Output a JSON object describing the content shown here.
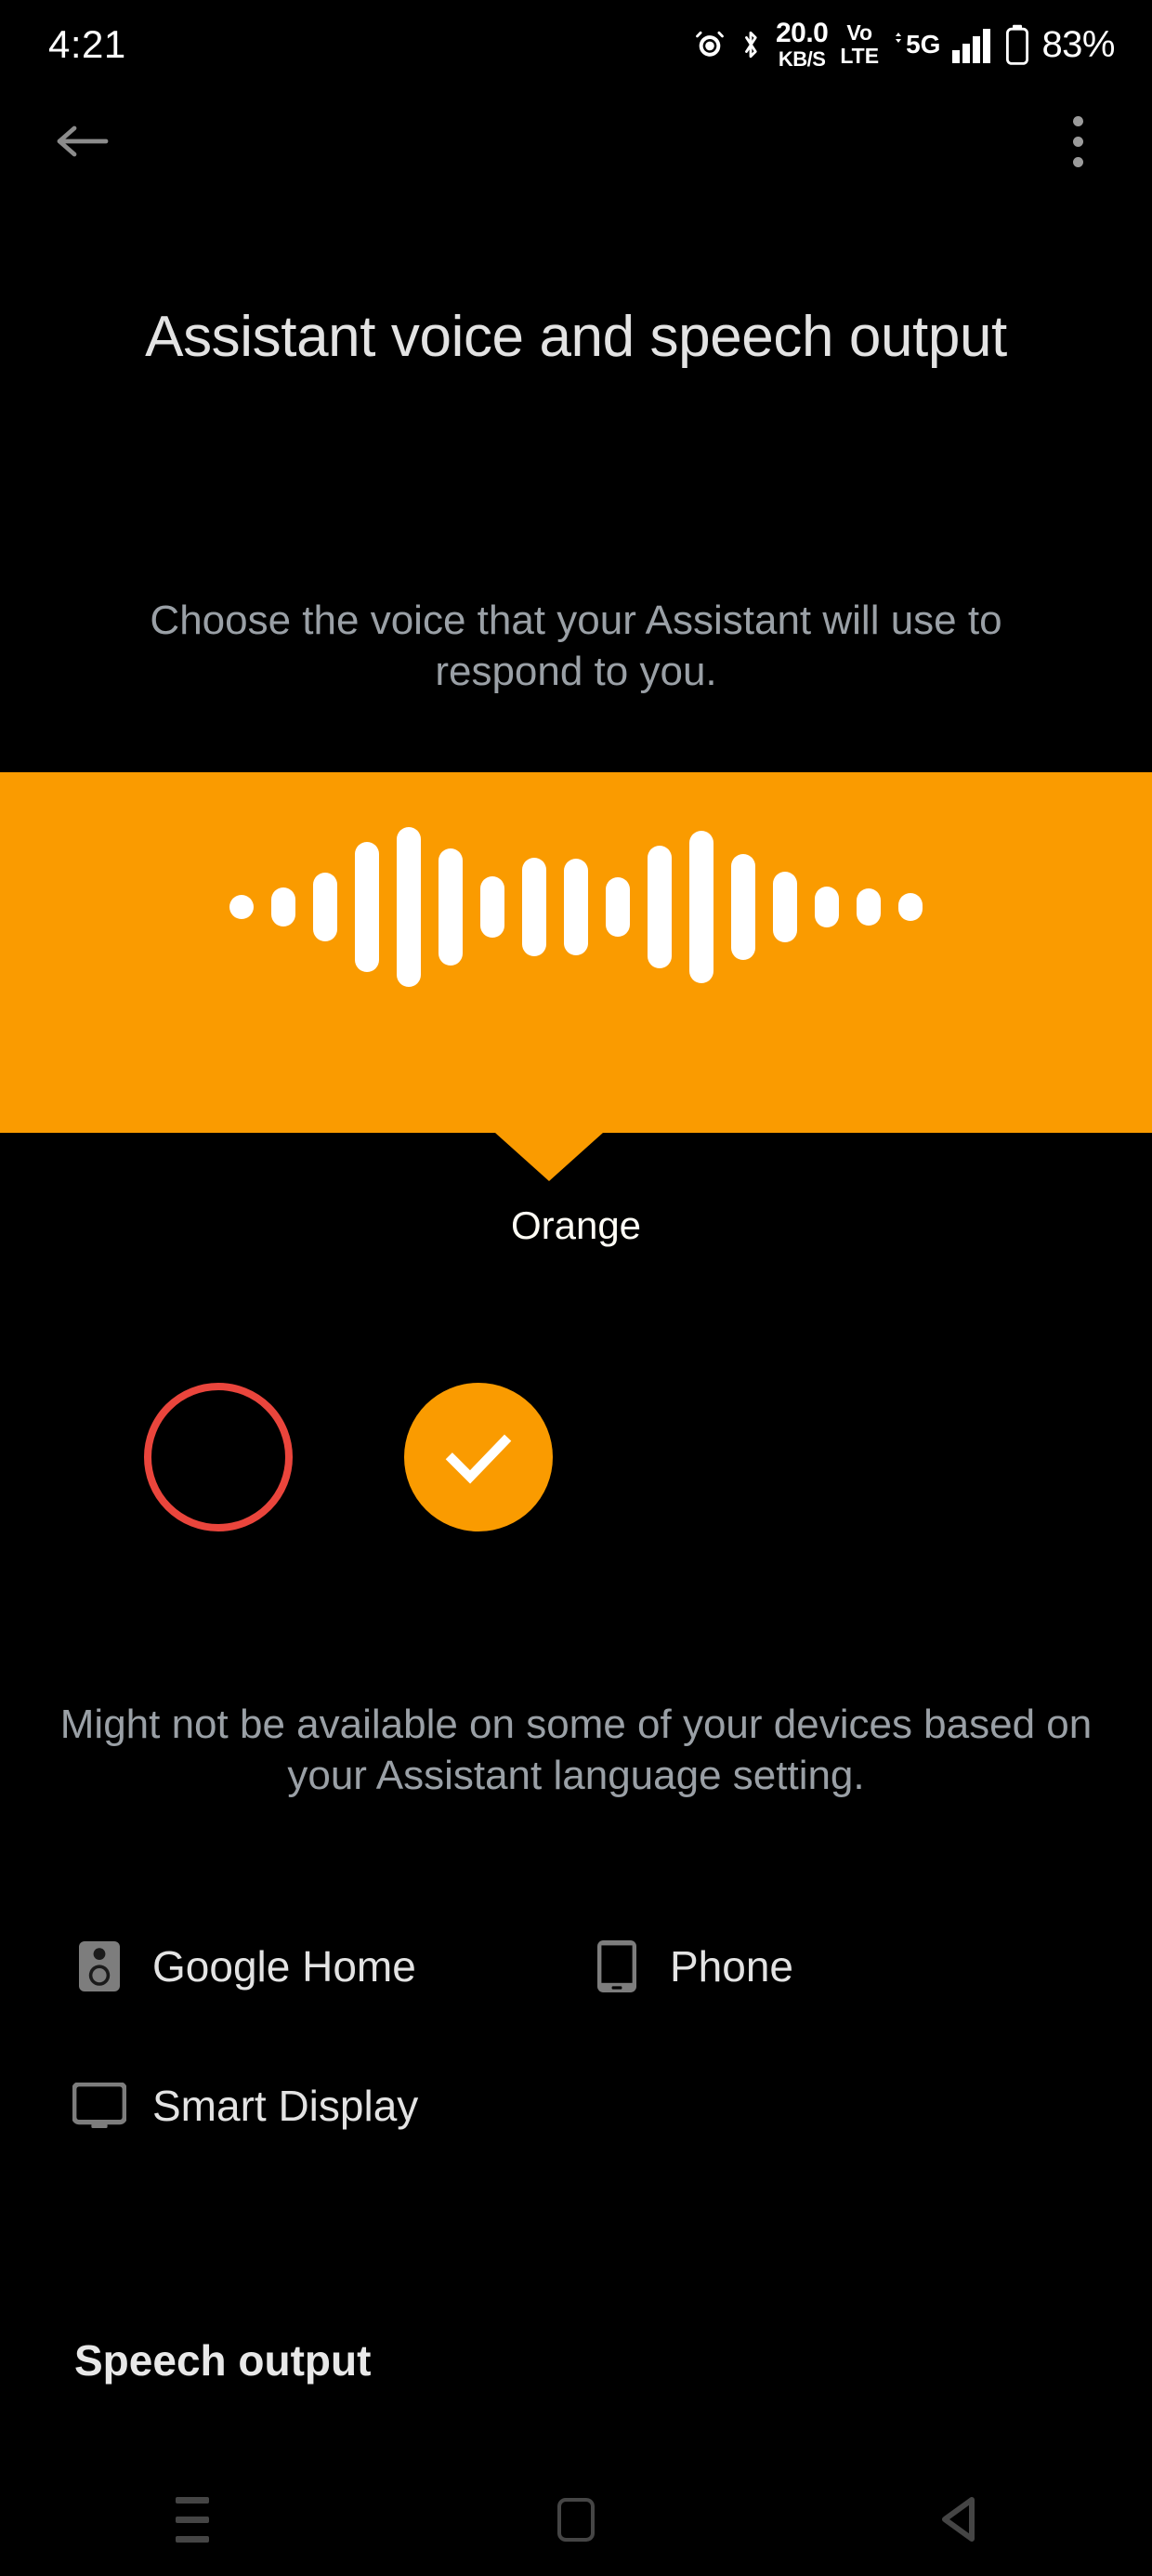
{
  "statusbar": {
    "clock": "4:21",
    "alarm_icon": "alarm-icon",
    "bluetooth_icon": "bluetooth-icon",
    "network_speed_value": "20.0",
    "network_speed_unit": "KB/S",
    "volte_line1": "Vo",
    "volte_line2": "LTE",
    "mobile_network": "5G",
    "signal_icon": "signal-bars-icon",
    "battery_icon": "battery-icon",
    "battery_percent": "83%"
  },
  "appbar": {
    "back_icon": "back-arrow-icon",
    "overflow_icon": "more-vert-icon"
  },
  "header": {
    "title": "Assistant voice and speech output",
    "subtitle": "Choose the voice that your Assistant will use to respond to you."
  },
  "voice_preview": {
    "panel_color": "#fa9b00",
    "voice_name": "Orange",
    "waveform_icon": "voice-waveform-icon",
    "waveform_bars": [
      26,
      42,
      74,
      140,
      172,
      126,
      66,
      106,
      104,
      64,
      132,
      164,
      114,
      76,
      44,
      40,
      30
    ]
  },
  "voice_options": [
    {
      "name": "Red",
      "selected": false,
      "color": "#ea453c",
      "icon": "voice-color-circle-red"
    },
    {
      "name": "Orange",
      "selected": true,
      "color": "#fa9b00",
      "icon": "check-icon"
    }
  ],
  "note": "Might not be available on some of your devices based on your Assistant language setting.",
  "devices": [
    {
      "label": "Google Home",
      "icon": "speaker-icon"
    },
    {
      "label": "Phone",
      "icon": "phone-icon"
    },
    {
      "label": "Smart Display",
      "icon": "monitor-icon"
    }
  ],
  "sections": {
    "speech_output_title": "Speech output"
  },
  "navbar": {
    "recents_icon": "menu-recents-icon",
    "home_icon": "home-square-icon",
    "back_icon": "back-triangle-icon"
  }
}
